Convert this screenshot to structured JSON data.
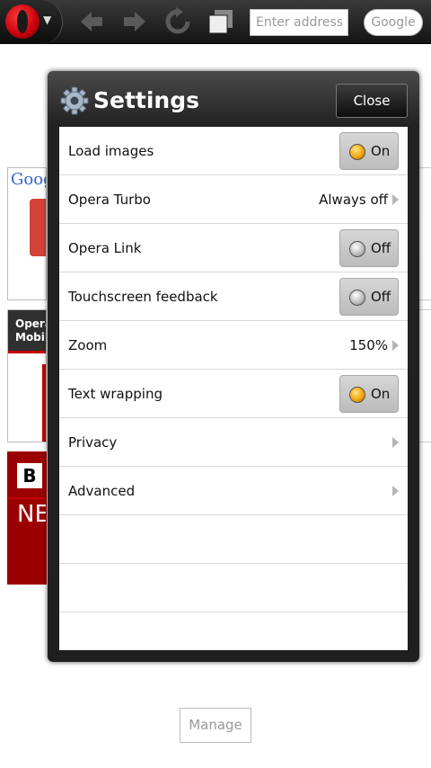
{
  "toolbar": {
    "address_placeholder": "Enter address",
    "search_label": "Google"
  },
  "speed_dial": {
    "google_tile_text": "Goog",
    "opera_tile_lines": [
      "Opera",
      "Mobil"
    ],
    "bbc_tile_logo": "B",
    "bbc_tile_text": "NE",
    "manage_label": "Manage"
  },
  "settings": {
    "title": "Settings",
    "close_label": "Close",
    "rows": [
      {
        "label": "Load images",
        "kind": "toggle",
        "value": "On"
      },
      {
        "label": "Opera Turbo",
        "kind": "value",
        "value": "Always off"
      },
      {
        "label": "Opera Link",
        "kind": "toggle",
        "value": "Off"
      },
      {
        "label": "Touchscreen feedback",
        "kind": "toggle",
        "value": "Off"
      },
      {
        "label": "Zoom",
        "kind": "value",
        "value": "150%"
      },
      {
        "label": "Text wrapping",
        "kind": "toggle",
        "value": "On"
      },
      {
        "label": "Privacy",
        "kind": "link"
      },
      {
        "label": "Advanced",
        "kind": "link"
      }
    ]
  },
  "colors": {
    "toggle_on_led": "#f0a000",
    "toggle_off_led": "#b9b9b9",
    "opera_red": "#c4000a",
    "bbc_red": "#9b0000"
  }
}
